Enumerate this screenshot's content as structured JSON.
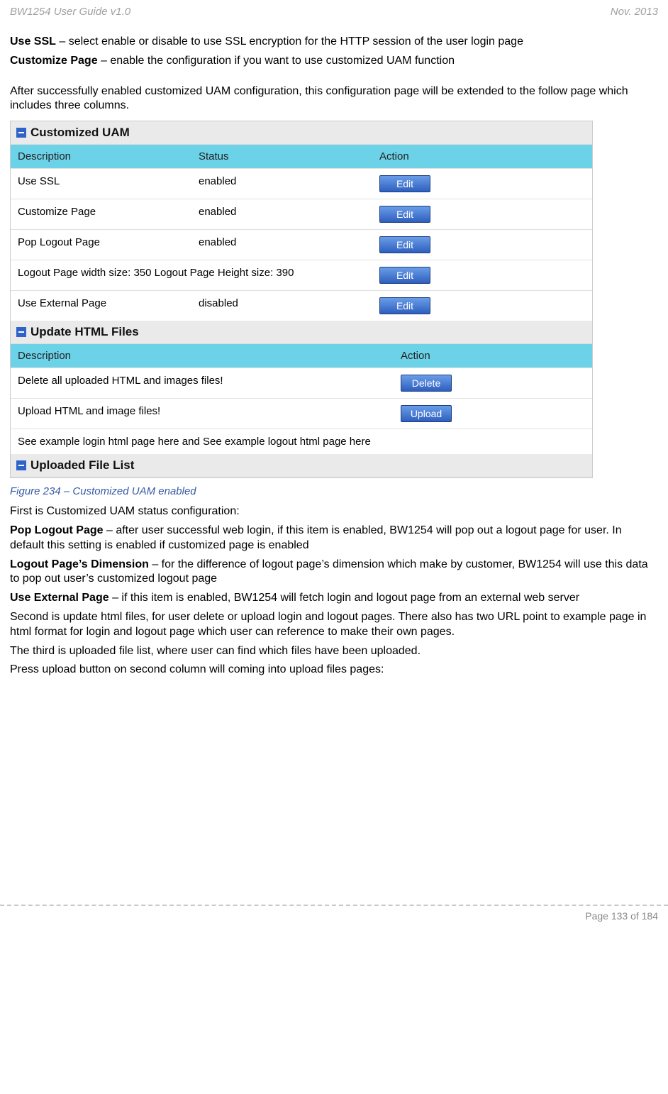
{
  "header": {
    "left": "BW1254 User Guide v1.0",
    "right": "Nov.  2013"
  },
  "intro": {
    "useSSL_label": "Use SSL",
    "useSSL_text": " – select enable or disable to use SSL encryption for the HTTP session of the user login page",
    "customize_label": "Customize Page",
    "customize_text": " – enable the configuration if you want to use customized UAM function",
    "after": "After successfully enabled customized UAM configuration, this configuration page will be extended to the follow page which includes three columns."
  },
  "shot": {
    "sec1": "Customized UAM",
    "head1": {
      "c1": "Description",
      "c2": "Status",
      "c3": "Action"
    },
    "rows1": [
      {
        "c1": "Use SSL",
        "c2": "enabled",
        "btn": "Edit"
      },
      {
        "c1": "Customize Page",
        "c2": "enabled",
        "btn": "Edit"
      },
      {
        "c1": "Pop Logout Page",
        "c2": "enabled",
        "btn": "Edit"
      },
      {
        "c1": "Logout Page width size: 350  Logout Page Height size: 390",
        "c2": "",
        "btn": "Edit",
        "span": true
      },
      {
        "c1": "Use External Page",
        "c2": "disabled",
        "btn": "Edit"
      }
    ],
    "sec2": "Update HTML Files",
    "head2": {
      "cL": "Description",
      "cR": "Action"
    },
    "rows2": [
      {
        "cL": "Delete all uploaded HTML and images files!",
        "btn": "Delete"
      },
      {
        "cL": "Upload HTML and image files!",
        "btn": "Upload"
      },
      {
        "cL": "See example login html page here and See example logout html page here",
        "plain": true
      }
    ],
    "sec3": "Uploaded File List"
  },
  "caption": "Figure 234 – Customized UAM enabled",
  "post": {
    "p1": "First is Customized UAM status configuration:",
    "pop_label": "Pop Logout Page",
    "pop_text": " – after user successful web login, if this item is enabled, BW1254 will pop out a logout page for user. In default this setting is enabled if customized page is enabled",
    "dim_label": "Logout Page’s Dimension",
    "dim_text": " – for the difference of logout page’s dimension which make by customer, BW1254 will use this data to pop out user’s customized logout page",
    "ext_label": "Use External Page",
    "ext_text": " – if this item is enabled, BW1254 will fetch login and logout page from an external web server",
    "p2": "Second is update html files, for user delete or upload login and logout pages. There also has two URL point to example page in html format for login and logout page which user can reference to make their own pages.",
    "p3": "The third is uploaded file list, where user can find which files have been uploaded.",
    "p4": "Press upload button on second column will coming into upload files pages:"
  },
  "footer": "Page 133 of 184"
}
